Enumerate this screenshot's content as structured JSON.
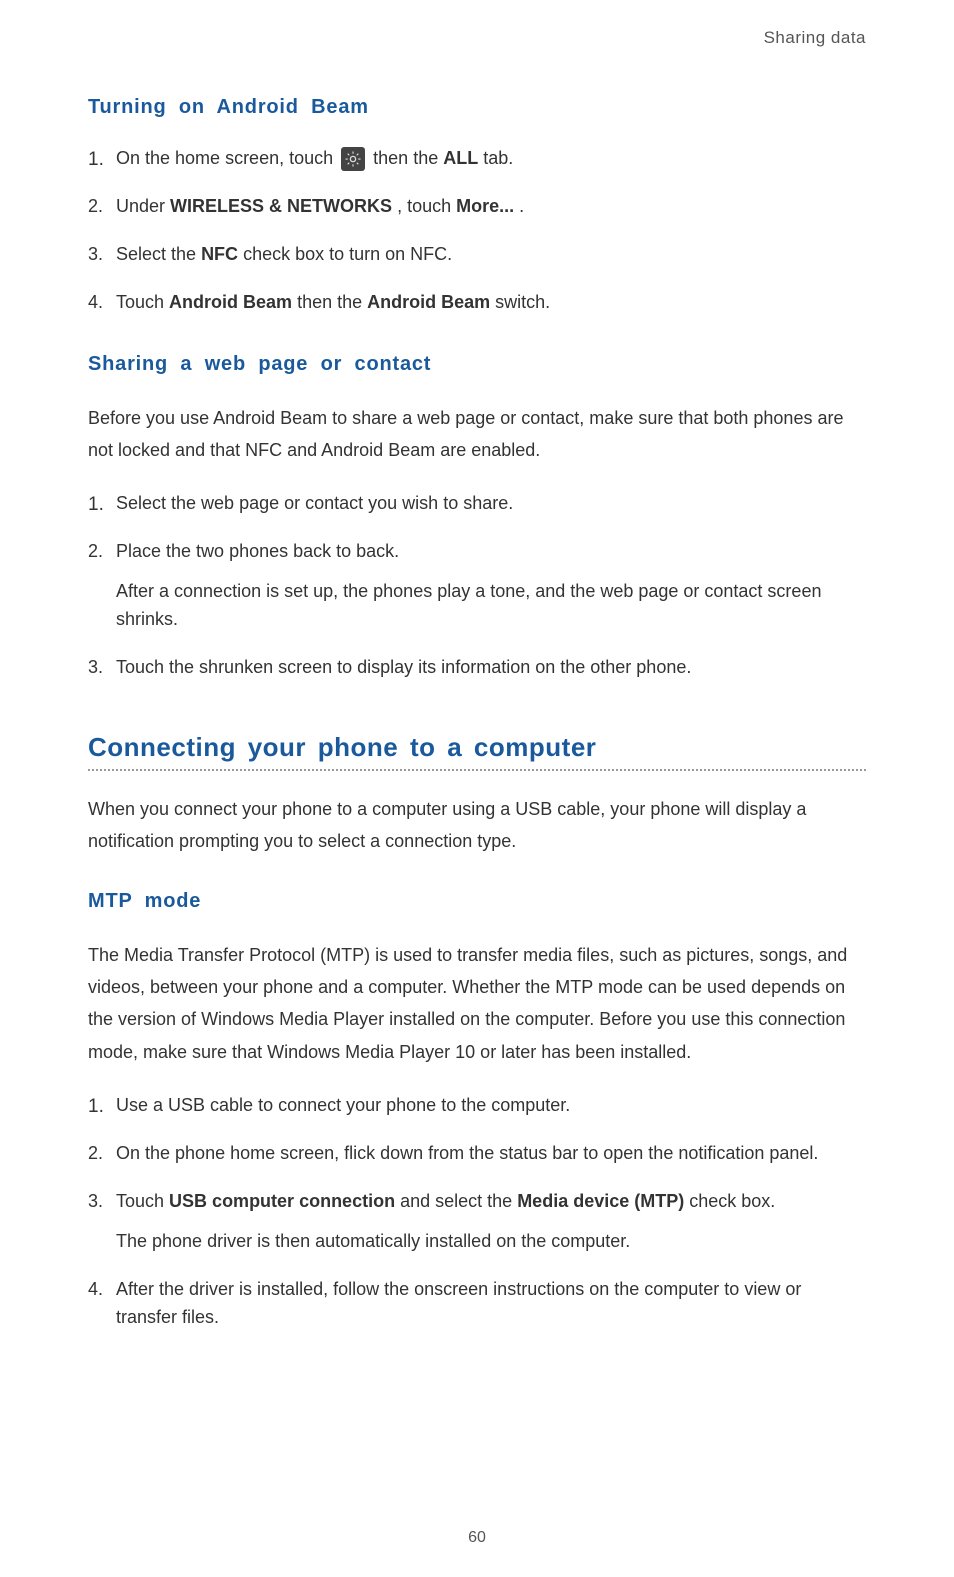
{
  "header": {
    "section_label": "Sharing data"
  },
  "sections": {
    "turning_on": {
      "title": "Turning on Android Beam",
      "step1_before": "On the home screen, touch ",
      "step1_after_icon": " then the ",
      "step1_bold": "ALL",
      "step1_end": " tab.",
      "step2_a": "Under ",
      "step2_bold1": "WIRELESS & NETWORKS",
      "step2_b": ", touch ",
      "step2_bold2": "More...",
      "step2_c": ".",
      "step3_a": "Select the ",
      "step3_bold": "NFC",
      "step3_b": " check box to turn on NFC.",
      "step4_a": "Touch ",
      "step4_bold1": "Android Beam",
      "step4_b": " then the ",
      "step4_bold2": "Android Beam",
      "step4_c": " switch."
    },
    "sharing_web": {
      "title": "Sharing a web page or contact",
      "intro": "Before you use Android Beam to share a web page or contact, make sure that both phones are not locked and that NFC and Android Beam are enabled.",
      "step1": "Select the web page or contact you wish to share.",
      "step2": "Place the two phones back to back.",
      "step2_sub": "After a connection is set up, the phones play a tone, and the web page or contact screen shrinks.",
      "step3": "Touch the shrunken screen to display its information on the other phone."
    },
    "connecting": {
      "title": "Connecting your phone to a computer",
      "intro": "When you connect your phone to a computer using a USB cable, your phone will display a notification prompting you to select a connection type."
    },
    "mtp": {
      "title": "MTP mode",
      "intro": "The Media Transfer Protocol (MTP) is used to transfer media files, such as pictures, songs, and videos, between your phone and a computer. Whether the MTP mode can be used depends on the version of Windows Media Player installed on the computer. Before you use this connection mode, make sure that Windows Media Player 10 or later has been installed.",
      "step1": "Use a USB cable to connect your phone to the computer.",
      "step2": "On the phone home screen, flick down from the status bar to open the notification panel.",
      "step3_a": "Touch ",
      "step3_bold1": "USB computer connection",
      "step3_b": " and select the ",
      "step3_bold2": "Media device (MTP)",
      "step3_c": " check box.",
      "step3_sub": "The phone driver is then automatically installed on the computer.",
      "step4": "After the driver is installed, follow the onscreen instructions on the computer to view or transfer files."
    }
  },
  "page_number": "60"
}
